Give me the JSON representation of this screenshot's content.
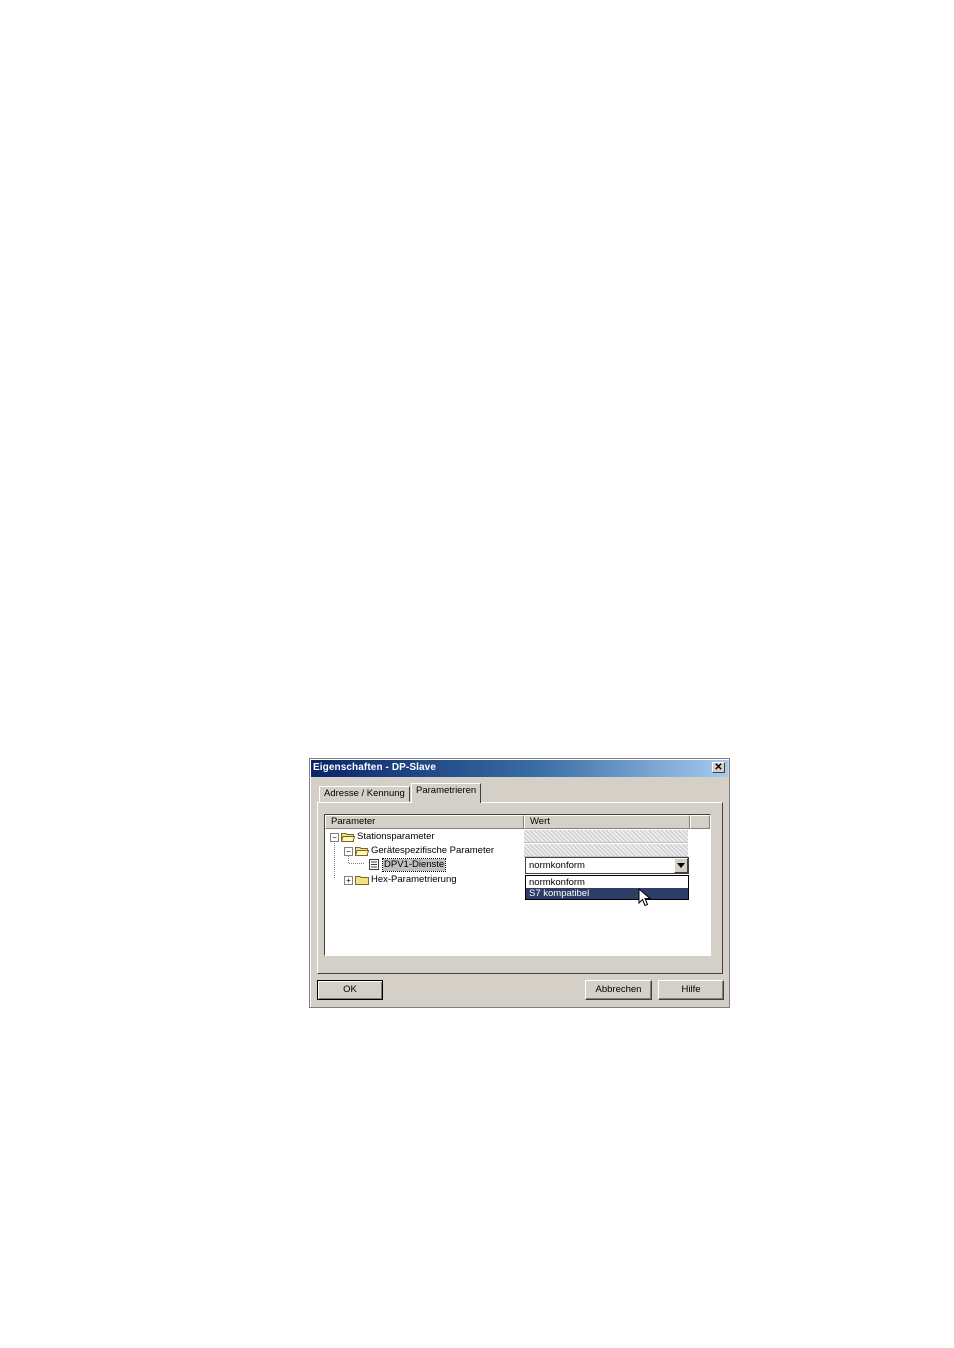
{
  "window": {
    "title": "Eigenschaften - DP-Slave",
    "close_glyph": "✕"
  },
  "tabs": [
    {
      "label": "Adresse / Kennung",
      "active": false
    },
    {
      "label": "Parametrieren",
      "active": true
    }
  ],
  "table": {
    "columns": [
      "Parameter",
      "Wert"
    ],
    "rows": [
      {
        "label": "Stationsparameter",
        "expander": "−",
        "icon": "folder-icon"
      },
      {
        "label": "Gerätespezifische Parameter",
        "expander": "−",
        "icon": "folder-icon"
      },
      {
        "label": "DPV1-Dienste",
        "icon": "document-icon",
        "selected": true
      },
      {
        "label": "Hex-Parametrierung",
        "expander": "+",
        "icon": "folder-icon"
      }
    ]
  },
  "combo": {
    "value": "normkonform",
    "options": [
      "normkonform",
      "S7 kompatibel"
    ],
    "highlighted": "S7 kompatibel",
    "highlight_color": "#2c3e66"
  },
  "buttons": {
    "ok": "OK",
    "cancel": "Abbrechen",
    "help": "Hilfe"
  }
}
